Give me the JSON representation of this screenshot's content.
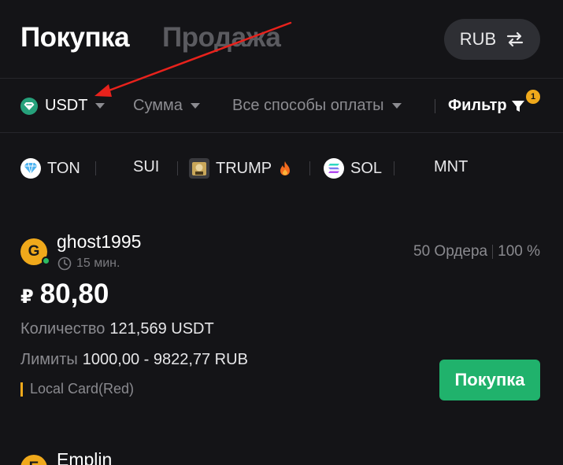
{
  "header": {
    "tab_buy": "Покупка",
    "tab_sell": "Продажа",
    "currency": "RUB"
  },
  "filters": {
    "asset": "USDT",
    "amount": "Сумма",
    "payment_methods": "Все способы оплаты",
    "filter_label": "Фильтр",
    "filter_badge": "1"
  },
  "coins": [
    {
      "label": "TON",
      "icon": "diamond-icon"
    },
    {
      "label": "SUI",
      "icon": ""
    },
    {
      "label": "TRUMP",
      "icon": "trump-icon",
      "badge_icon": "fire-icon"
    },
    {
      "label": "SOL",
      "icon": "solana-icon"
    },
    {
      "label": "MNT",
      "icon": ""
    }
  ],
  "offers": [
    {
      "avatar_letter": "G",
      "username": "ghost1995",
      "time": "15 мин.",
      "orders": "50 Ордера",
      "completion": "100 %",
      "currency_symbol": "₽",
      "price": "80,80",
      "quantity_label": "Количество",
      "quantity_value": "121,569 USDT",
      "limits_label": "Лимиты",
      "limits_value": "1000,00 - 9822,77 RUB",
      "payment_method": "Local Card(Red)",
      "action": "Покупка"
    },
    {
      "avatar_letter": "E",
      "username": "Emplin"
    }
  ],
  "colors": {
    "background": "#141417",
    "accent_green": "#20b26c",
    "accent_orange": "#f0a91b",
    "annotation_red": "#e8221c"
  }
}
